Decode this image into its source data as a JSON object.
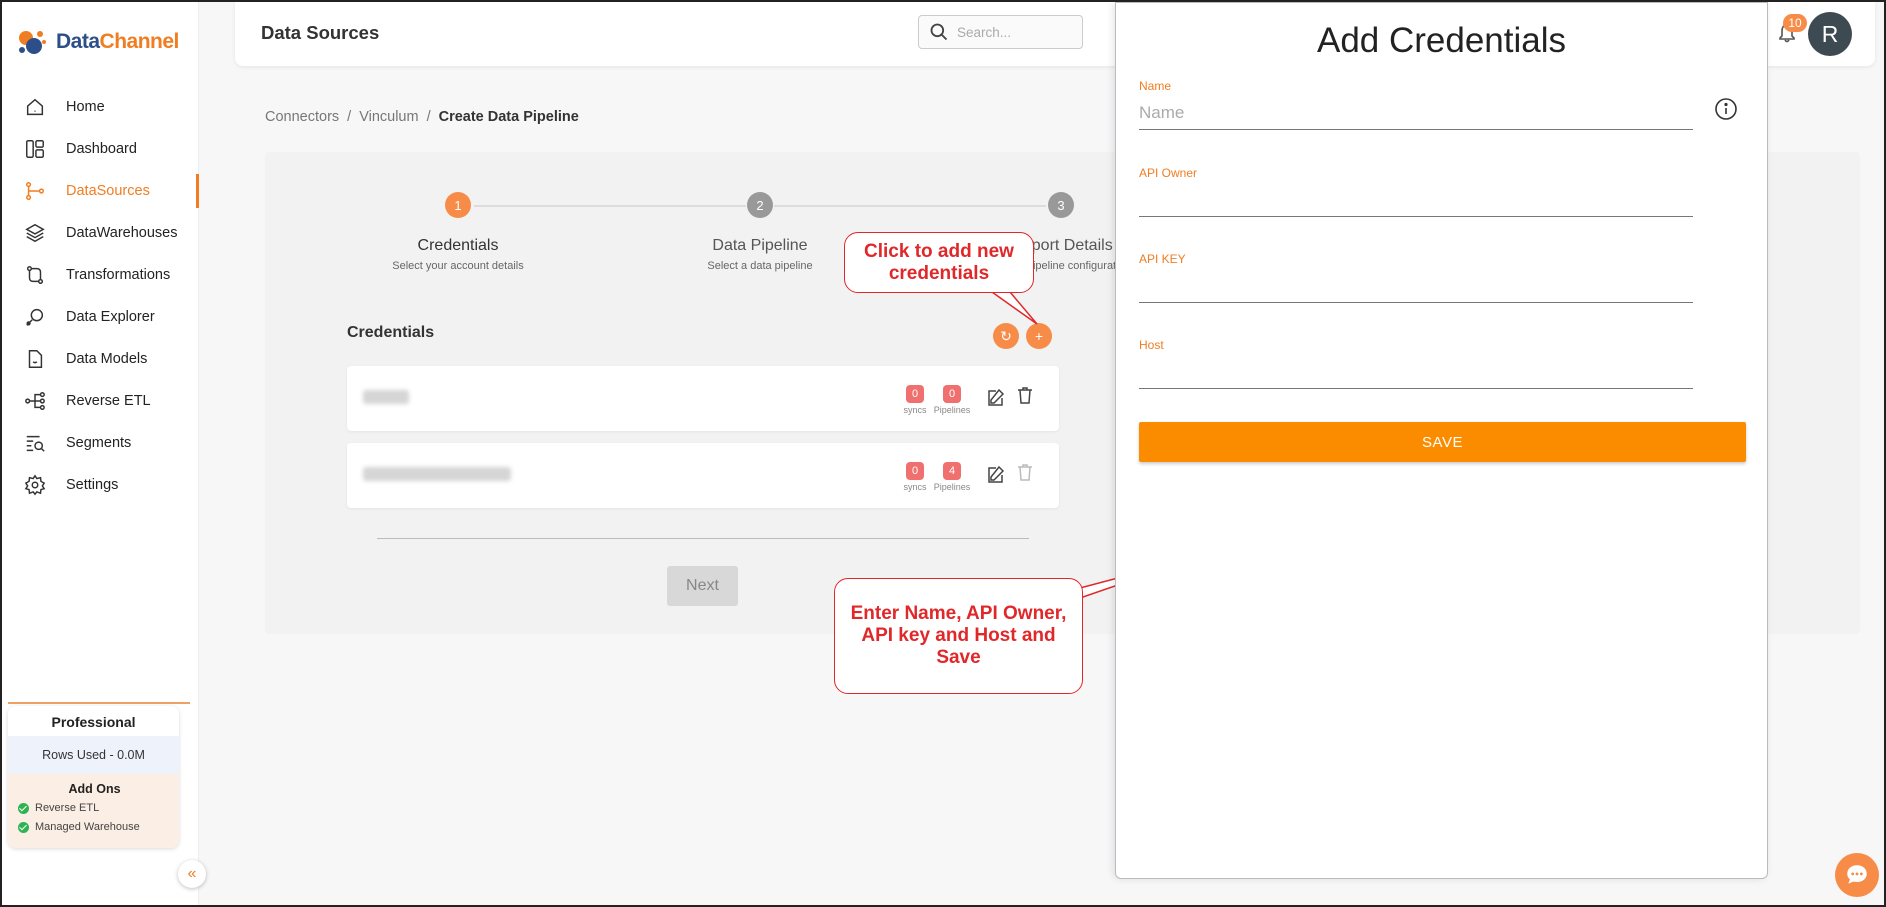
{
  "app": {
    "logo_text_1": "Data",
    "logo_text_2": "Channel"
  },
  "sidebar": {
    "items": [
      {
        "label": "Home",
        "icon": "home-icon",
        "active": false
      },
      {
        "label": "Dashboard",
        "icon": "dashboard-icon",
        "active": false
      },
      {
        "label": "DataSources",
        "icon": "datasources-icon",
        "active": true
      },
      {
        "label": "DataWarehouses",
        "icon": "layers-icon",
        "active": false
      },
      {
        "label": "Transformations",
        "icon": "transform-icon",
        "active": false
      },
      {
        "label": "Data Explorer",
        "icon": "explorer-icon",
        "active": false
      },
      {
        "label": "Data Models",
        "icon": "models-icon",
        "active": false
      },
      {
        "label": "Reverse ETL",
        "icon": "reverse-etl-icon",
        "active": false
      },
      {
        "label": "Segments",
        "icon": "segments-icon",
        "active": false
      },
      {
        "label": "Settings",
        "icon": "gear-icon",
        "active": false
      }
    ],
    "plan": {
      "title": "Professional",
      "rows_used": "Rows Used - 0.0M",
      "addons_title": "Add Ons",
      "addons": [
        "Reverse ETL",
        "Managed Warehouse"
      ]
    },
    "collapse_glyph": "«"
  },
  "header": {
    "title": "Data Sources",
    "search_placeholder": "Search...",
    "notifications_count": "10",
    "avatar_initial": "R"
  },
  "breadcrumb": {
    "items": [
      "Connectors",
      "Vinculum",
      "Create Data Pipeline"
    ],
    "separator": "/"
  },
  "stepper": {
    "steps": [
      {
        "num": "1",
        "title": "Credentials",
        "subtitle": "Select your account details",
        "active": true
      },
      {
        "num": "2",
        "title": "Data Pipeline",
        "subtitle": "Select a data pipeline",
        "active": false
      },
      {
        "num": "3",
        "title": "Report Details",
        "subtitle": "Select pipeline configuration",
        "active": false
      }
    ]
  },
  "credentials": {
    "title": "Credentials",
    "refresh_glyph": "↻",
    "add_glyph": "+",
    "rows": [
      {
        "syncs": "0",
        "pipelines": "0",
        "syncs_label": "syncs",
        "pipelines_label": "Pipelines"
      },
      {
        "syncs": "0",
        "pipelines": "4",
        "syncs_label": "syncs",
        "pipelines_label": "Pipelines"
      }
    ],
    "next_label": "Next"
  },
  "callouts": {
    "add_new": "Click to add new credentials",
    "enter_fields": "Enter Name, API Owner, API key and Host and Save"
  },
  "drawer": {
    "title": "Add Credentials",
    "fields": [
      {
        "label": "Name",
        "placeholder": "Name",
        "value": ""
      },
      {
        "label": "API Owner",
        "placeholder": "",
        "value": ""
      },
      {
        "label": "API KEY",
        "placeholder": "",
        "value": ""
      },
      {
        "label": "Host",
        "placeholder": "",
        "value": ""
      }
    ],
    "save_label": "SAVE"
  },
  "colors": {
    "accent": "#f07d22",
    "save": "#fb8c00",
    "callout": "#e0282a",
    "badge": "#f07070",
    "step_inactive": "#999999"
  }
}
